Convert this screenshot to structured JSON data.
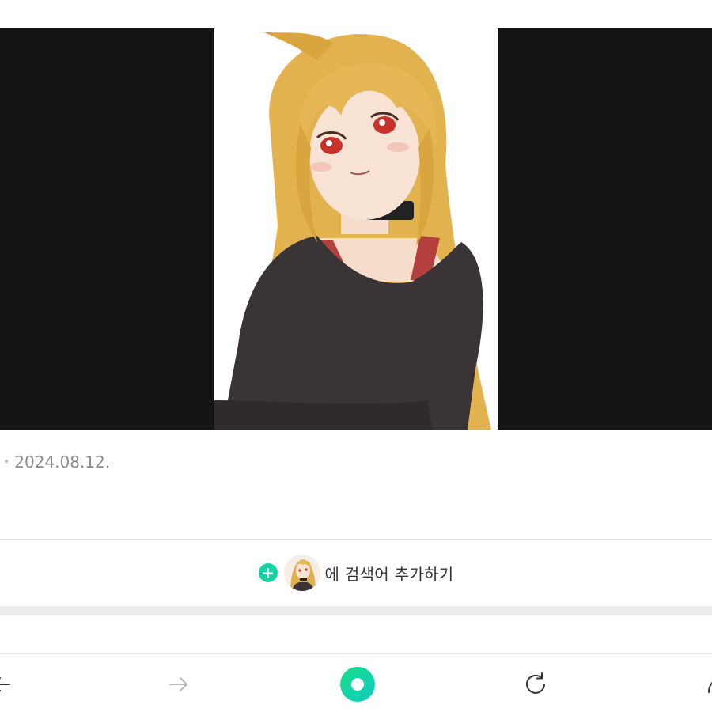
{
  "post": {
    "date": "2024.08.12.",
    "separator": "•"
  },
  "search_add": {
    "label": "에 검색어 추가하기",
    "plus_icon": "+",
    "accent_color": "#16d3a5"
  },
  "bottom_nav": {
    "buttons": [
      "back-arrow-icon",
      "forward-arrow-icon",
      "home-ring-icon",
      "refresh-icon",
      "share-icon"
    ],
    "home_color": "#16d3a5",
    "forward_disabled": true
  },
  "colors": {
    "viewer_background": "#141414",
    "date_text": "#8a8a8a"
  }
}
